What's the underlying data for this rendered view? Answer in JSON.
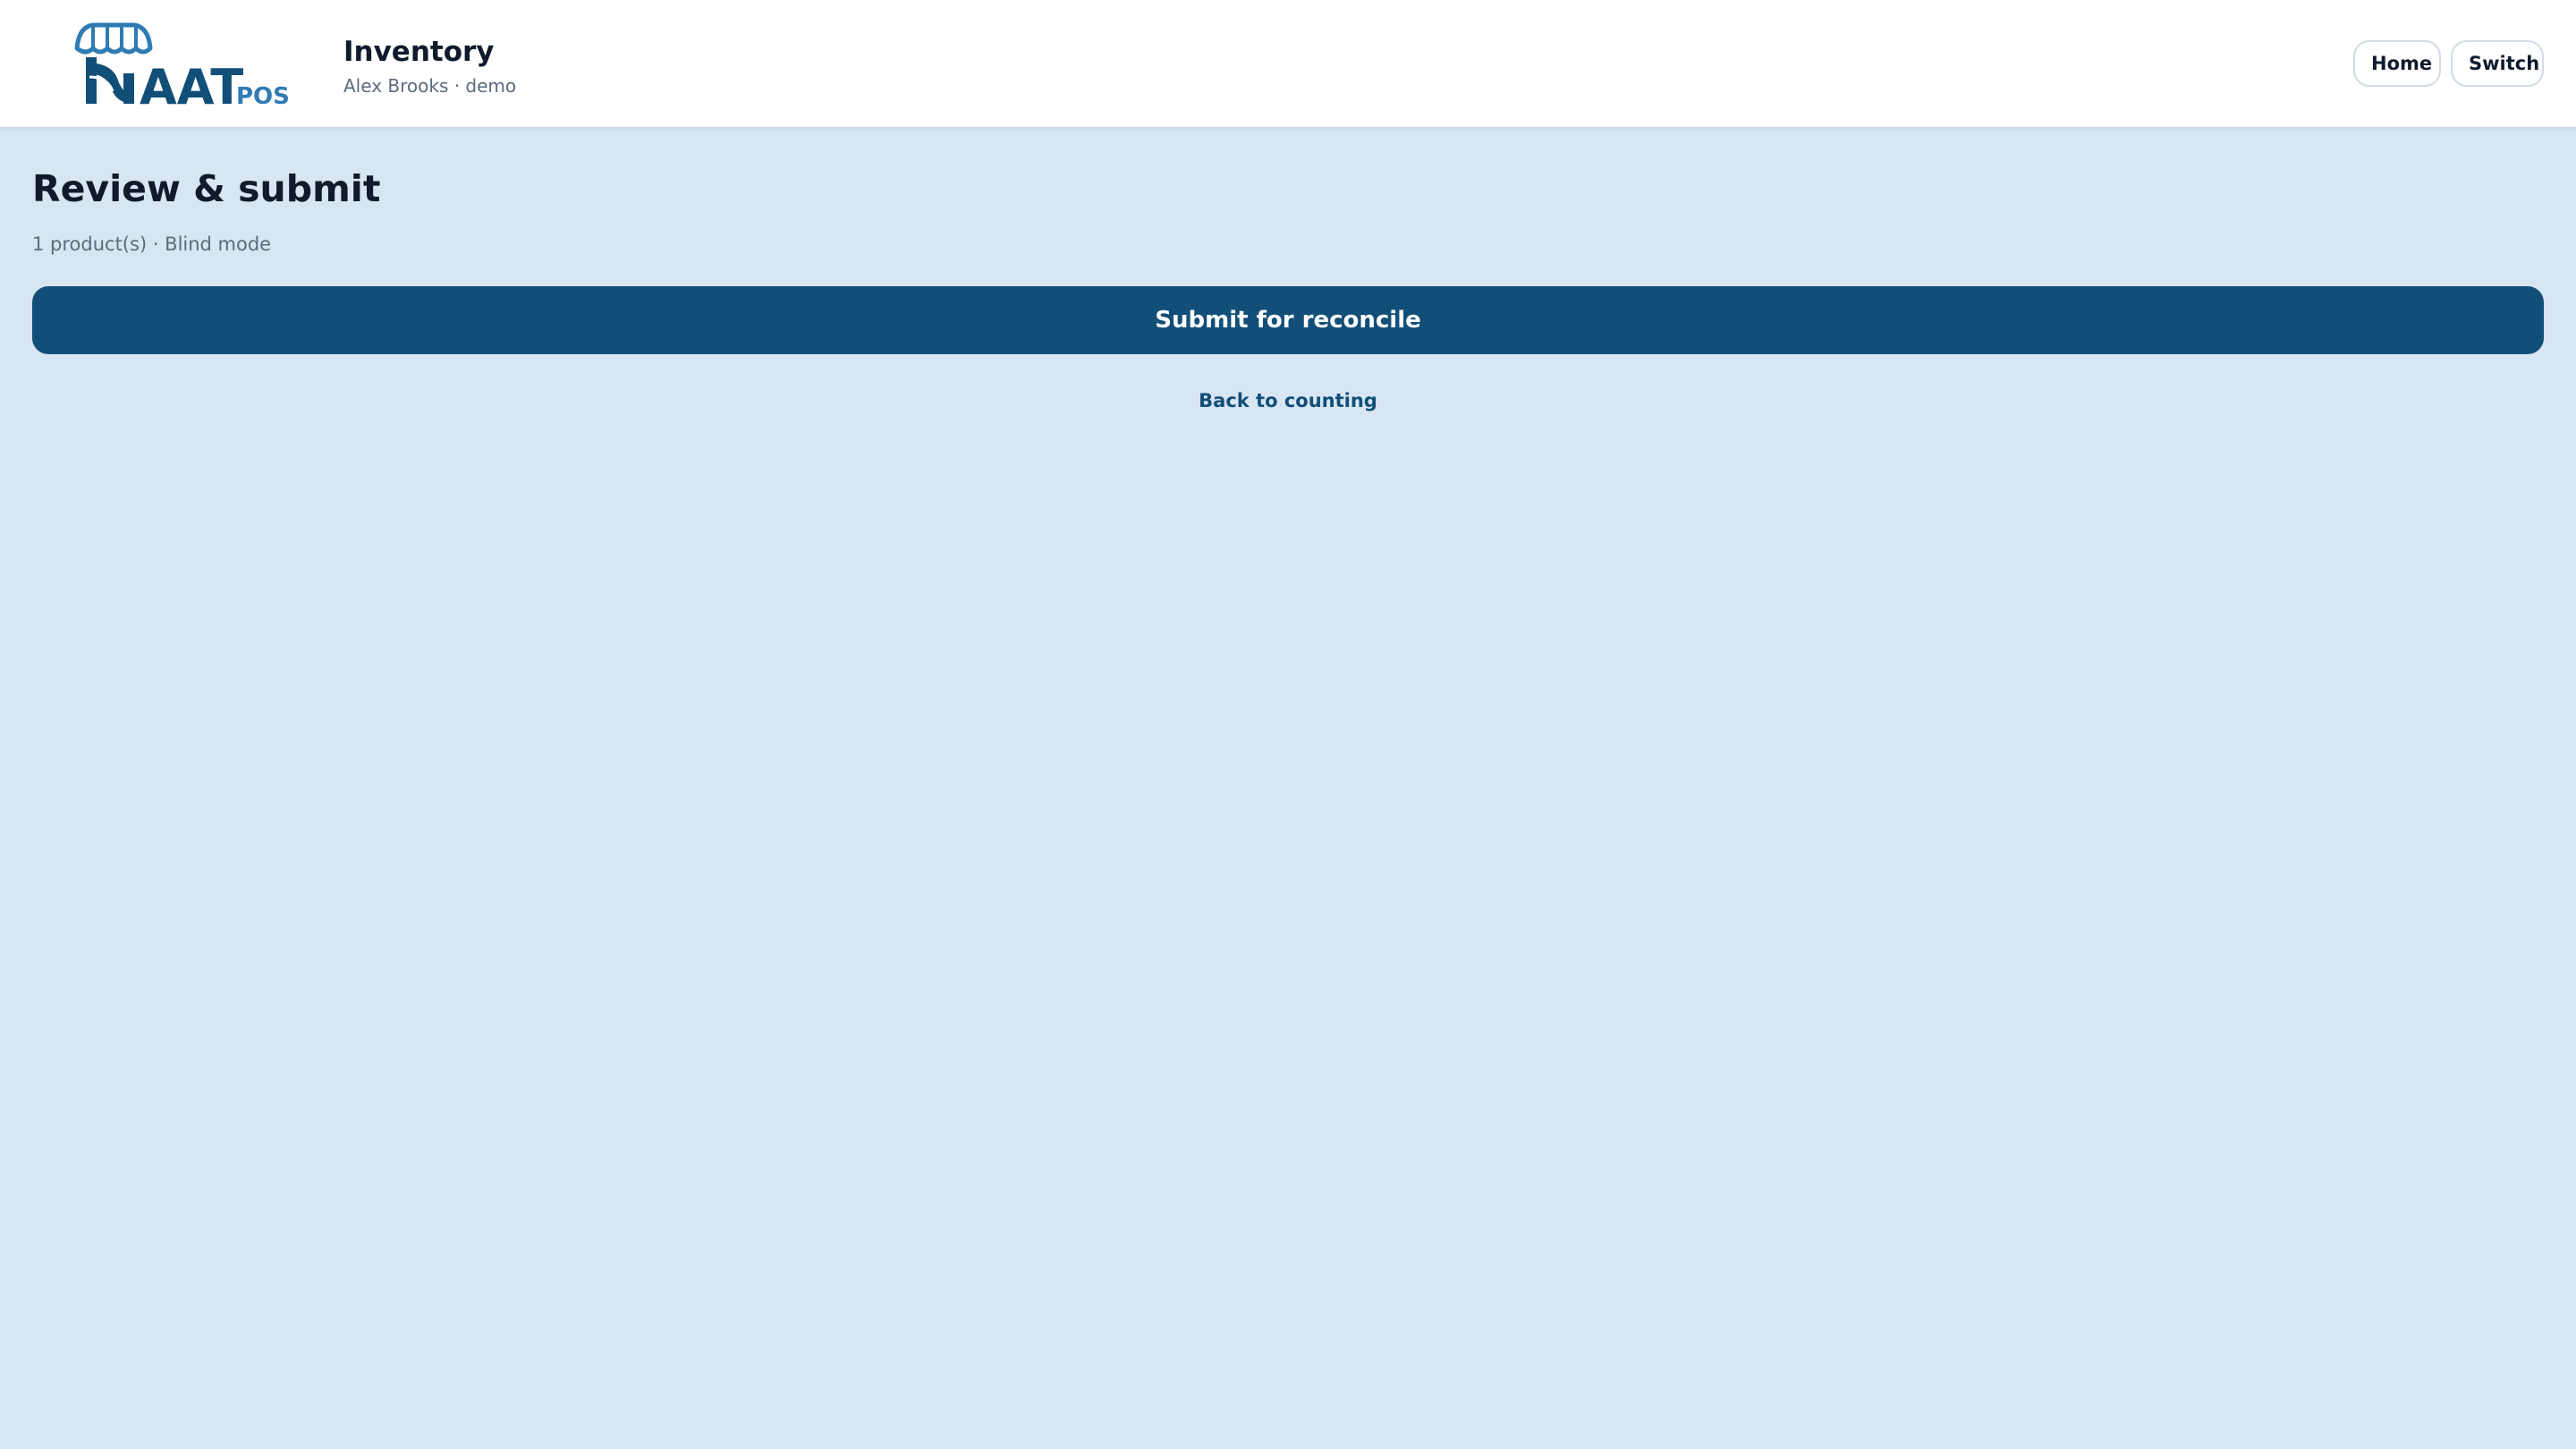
{
  "header": {
    "logo": {
      "text_main": "AAT",
      "text_suffix": "POS",
      "icon": "storefront-awning-icon",
      "brand_color": "#114f78",
      "accent_color": "#2f7bb3"
    },
    "title": "Inventory",
    "subtitle": "Alex Brooks · demo",
    "nav": {
      "home_label": "Home",
      "switch_label": "Switch"
    }
  },
  "main": {
    "heading": "Review & submit",
    "meta": "1 product(s) · Blind mode",
    "submit_label": "Submit for reconcile",
    "back_label": "Back to counting"
  },
  "colors": {
    "background": "#d8e6f3",
    "primary": "#114f78",
    "text": "#0f1b2d",
    "muted": "#5b6b7d"
  }
}
